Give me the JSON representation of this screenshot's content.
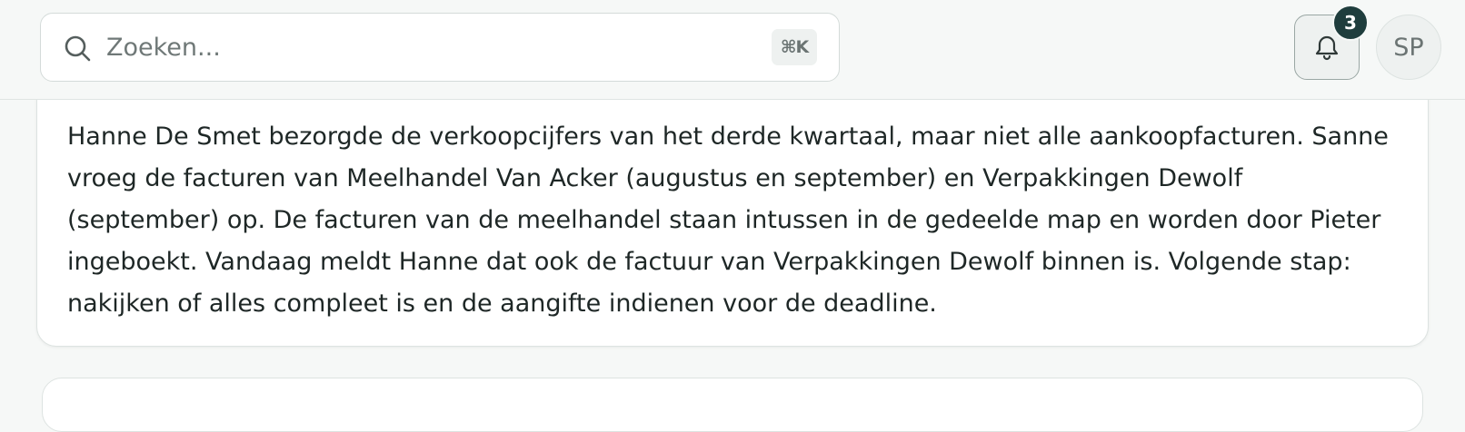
{
  "header": {
    "search": {
      "placeholder": "Zoeken...",
      "shortcut": "⌘K"
    },
    "notifications": {
      "count": "3"
    },
    "user": {
      "initials": "SP"
    }
  },
  "main": {
    "note": {
      "text": "Hanne De Smet bezorgde de verkoopcijfers van het derde kwartaal, maar niet alle aankoopfacturen. Sanne vroeg de facturen van Meelhandel Van Acker (augustus en september) en Verpakkingen Dewolf (september) op. De facturen van de meelhandel staan intussen in de gedeelde map en worden door Pieter ingeboekt. Vandaag meldt Hanne dat ook de factuur van Verpakkingen Dewolf binnen is. Volgende stap: nakijken of alles compleet is en de aangifte indienen voor de deadline."
    }
  }
}
